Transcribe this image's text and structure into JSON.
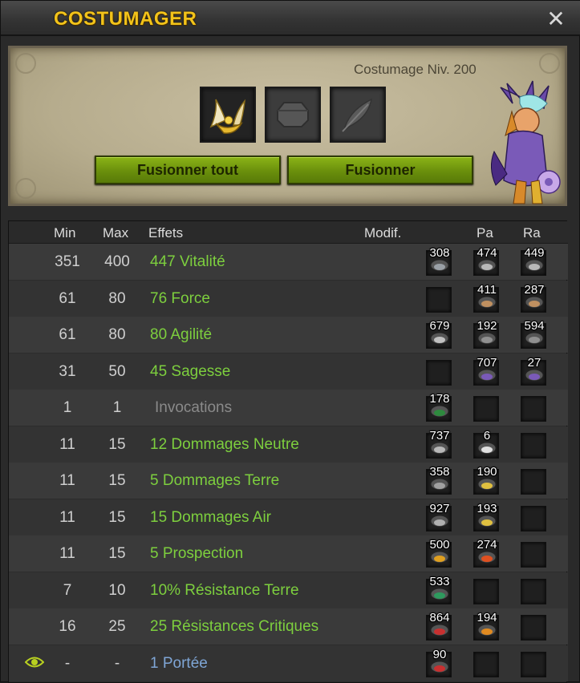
{
  "window": {
    "title": "COSTUMAGER"
  },
  "panel": {
    "level_label": "Costumage Niv. 200",
    "buttons": {
      "merge_all": "Fusionner tout",
      "merge": "Fusionner"
    },
    "slots": [
      "costume-item-icon",
      "empty-slot-icon",
      "feather-icon"
    ]
  },
  "table": {
    "headers": {
      "min": "Min",
      "max": "Max",
      "effects": "Effets",
      "modif": "Modif.",
      "pa": "Pa",
      "ra": "Ra"
    },
    "rows": [
      {
        "min": "351",
        "max": "400",
        "effect": "447 Vitalité",
        "style": "green",
        "runes": [
          "308",
          "474",
          "449"
        ]
      },
      {
        "min": "61",
        "max": "80",
        "effect": "76 Force",
        "style": "green",
        "runes": [
          "",
          "411",
          "287"
        ]
      },
      {
        "min": "61",
        "max": "80",
        "effect": "80 Agilité",
        "style": "green",
        "runes": [
          "679",
          "192",
          "594"
        ]
      },
      {
        "min": "31",
        "max": "50",
        "effect": "45 Sagesse",
        "style": "green",
        "runes": [
          "",
          "707",
          "27"
        ]
      },
      {
        "min": "1",
        "max": "1",
        "effect": "Invocations",
        "style": "gray",
        "runes": [
          "178",
          "",
          ""
        ]
      },
      {
        "min": "11",
        "max": "15",
        "effect": "12 Dommages Neutre",
        "style": "green",
        "runes": [
          "737",
          "6",
          ""
        ]
      },
      {
        "min": "11",
        "max": "15",
        "effect": "5 Dommages Terre",
        "style": "green",
        "runes": [
          "358",
          "190",
          ""
        ]
      },
      {
        "min": "11",
        "max": "15",
        "effect": "15 Dommages Air",
        "style": "green",
        "runes": [
          "927",
          "193",
          ""
        ]
      },
      {
        "min": "11",
        "max": "15",
        "effect": "5 Prospection",
        "style": "green",
        "runes": [
          "500",
          "274",
          ""
        ]
      },
      {
        "min": "7",
        "max": "10",
        "effect": "10% Résistance Terre",
        "style": "green",
        "runes": [
          "533",
          "",
          ""
        ]
      },
      {
        "min": "16",
        "max": "25",
        "effect": "25 Résistances Critiques",
        "style": "green",
        "runes": [
          "864",
          "194",
          ""
        ]
      },
      {
        "min": "-",
        "max": "-",
        "effect": "1 Portée",
        "style": "blue",
        "runes": [
          "90",
          "",
          ""
        ]
      }
    ]
  },
  "colors": {
    "title": "#f2c31a",
    "button": "#6a8f0c",
    "effect_green": "#7dcf3e",
    "effect_blue": "#7fa6d6"
  }
}
